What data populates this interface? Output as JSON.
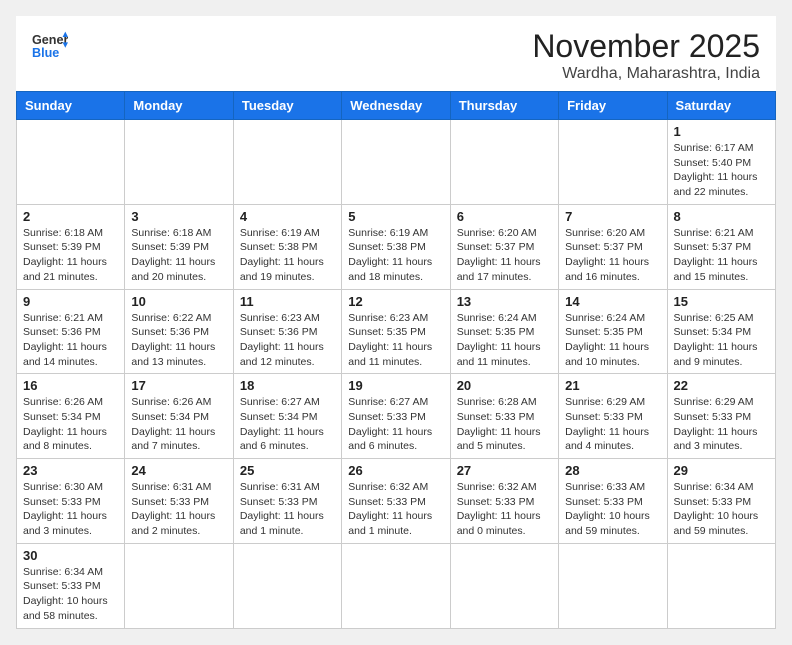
{
  "header": {
    "logo_general": "General",
    "logo_blue": "Blue",
    "title": "November 2025",
    "subtitle": "Wardha, Maharashtra, India"
  },
  "weekdays": [
    "Sunday",
    "Monday",
    "Tuesday",
    "Wednesday",
    "Thursday",
    "Friday",
    "Saturday"
  ],
  "days": [
    {
      "date": "",
      "info": ""
    },
    {
      "date": "",
      "info": ""
    },
    {
      "date": "",
      "info": ""
    },
    {
      "date": "",
      "info": ""
    },
    {
      "date": "",
      "info": ""
    },
    {
      "date": "",
      "info": ""
    },
    {
      "date": "1",
      "info": "Sunrise: 6:17 AM\nSunset: 5:40 PM\nDaylight: 11 hours\nand 22 minutes."
    },
    {
      "date": "2",
      "info": "Sunrise: 6:18 AM\nSunset: 5:39 PM\nDaylight: 11 hours\nand 21 minutes."
    },
    {
      "date": "3",
      "info": "Sunrise: 6:18 AM\nSunset: 5:39 PM\nDaylight: 11 hours\nand 20 minutes."
    },
    {
      "date": "4",
      "info": "Sunrise: 6:19 AM\nSunset: 5:38 PM\nDaylight: 11 hours\nand 19 minutes."
    },
    {
      "date": "5",
      "info": "Sunrise: 6:19 AM\nSunset: 5:38 PM\nDaylight: 11 hours\nand 18 minutes."
    },
    {
      "date": "6",
      "info": "Sunrise: 6:20 AM\nSunset: 5:37 PM\nDaylight: 11 hours\nand 17 minutes."
    },
    {
      "date": "7",
      "info": "Sunrise: 6:20 AM\nSunset: 5:37 PM\nDaylight: 11 hours\nand 16 minutes."
    },
    {
      "date": "8",
      "info": "Sunrise: 6:21 AM\nSunset: 5:37 PM\nDaylight: 11 hours\nand 15 minutes."
    },
    {
      "date": "9",
      "info": "Sunrise: 6:21 AM\nSunset: 5:36 PM\nDaylight: 11 hours\nand 14 minutes."
    },
    {
      "date": "10",
      "info": "Sunrise: 6:22 AM\nSunset: 5:36 PM\nDaylight: 11 hours\nand 13 minutes."
    },
    {
      "date": "11",
      "info": "Sunrise: 6:23 AM\nSunset: 5:36 PM\nDaylight: 11 hours\nand 12 minutes."
    },
    {
      "date": "12",
      "info": "Sunrise: 6:23 AM\nSunset: 5:35 PM\nDaylight: 11 hours\nand 11 minutes."
    },
    {
      "date": "13",
      "info": "Sunrise: 6:24 AM\nSunset: 5:35 PM\nDaylight: 11 hours\nand 11 minutes."
    },
    {
      "date": "14",
      "info": "Sunrise: 6:24 AM\nSunset: 5:35 PM\nDaylight: 11 hours\nand 10 minutes."
    },
    {
      "date": "15",
      "info": "Sunrise: 6:25 AM\nSunset: 5:34 PM\nDaylight: 11 hours\nand 9 minutes."
    },
    {
      "date": "16",
      "info": "Sunrise: 6:26 AM\nSunset: 5:34 PM\nDaylight: 11 hours\nand 8 minutes."
    },
    {
      "date": "17",
      "info": "Sunrise: 6:26 AM\nSunset: 5:34 PM\nDaylight: 11 hours\nand 7 minutes."
    },
    {
      "date": "18",
      "info": "Sunrise: 6:27 AM\nSunset: 5:34 PM\nDaylight: 11 hours\nand 6 minutes."
    },
    {
      "date": "19",
      "info": "Sunrise: 6:27 AM\nSunset: 5:33 PM\nDaylight: 11 hours\nand 6 minutes."
    },
    {
      "date": "20",
      "info": "Sunrise: 6:28 AM\nSunset: 5:33 PM\nDaylight: 11 hours\nand 5 minutes."
    },
    {
      "date": "21",
      "info": "Sunrise: 6:29 AM\nSunset: 5:33 PM\nDaylight: 11 hours\nand 4 minutes."
    },
    {
      "date": "22",
      "info": "Sunrise: 6:29 AM\nSunset: 5:33 PM\nDaylight: 11 hours\nand 3 minutes."
    },
    {
      "date": "23",
      "info": "Sunrise: 6:30 AM\nSunset: 5:33 PM\nDaylight: 11 hours\nand 3 minutes."
    },
    {
      "date": "24",
      "info": "Sunrise: 6:31 AM\nSunset: 5:33 PM\nDaylight: 11 hours\nand 2 minutes."
    },
    {
      "date": "25",
      "info": "Sunrise: 6:31 AM\nSunset: 5:33 PM\nDaylight: 11 hours\nand 1 minute."
    },
    {
      "date": "26",
      "info": "Sunrise: 6:32 AM\nSunset: 5:33 PM\nDaylight: 11 hours\nand 1 minute."
    },
    {
      "date": "27",
      "info": "Sunrise: 6:32 AM\nSunset: 5:33 PM\nDaylight: 11 hours\nand 0 minutes."
    },
    {
      "date": "28",
      "info": "Sunrise: 6:33 AM\nSunset: 5:33 PM\nDaylight: 10 hours\nand 59 minutes."
    },
    {
      "date": "29",
      "info": "Sunrise: 6:34 AM\nSunset: 5:33 PM\nDaylight: 10 hours\nand 59 minutes."
    },
    {
      "date": "30",
      "info": "Sunrise: 6:34 AM\nSunset: 5:33 PM\nDaylight: 10 hours\nand 58 minutes."
    },
    {
      "date": "",
      "info": ""
    },
    {
      "date": "",
      "info": ""
    },
    {
      "date": "",
      "info": ""
    },
    {
      "date": "",
      "info": ""
    },
    {
      "date": "",
      "info": ""
    },
    {
      "date": "",
      "info": ""
    }
  ]
}
